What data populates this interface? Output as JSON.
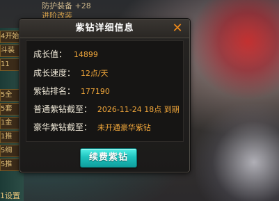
{
  "background": {
    "top_text_1": "防护装备 +28",
    "top_text_2": "进阶改装",
    "left_items": [
      "4开始",
      "斗装",
      "11",
      "5全",
      "5套",
      "1金",
      "1推",
      "5绸",
      "5推"
    ],
    "bottom_text": "1设置"
  },
  "dialog": {
    "title": "紫钻详细信息",
    "close_label": "✕",
    "rows": [
      {
        "label": "成长值：",
        "value": "14899"
      },
      {
        "label": "成长速度：",
        "value": "12点/天"
      },
      {
        "label": "紫钻排名：",
        "value": "177190"
      },
      {
        "label": "普通紫钻截至：",
        "value": "2026-11-24 18点 到期"
      },
      {
        "label": "豪华紫钻截至：",
        "value": "未开通豪华紫钻"
      }
    ],
    "renew_label": "续费紫钻"
  },
  "colors": {
    "accent_orange": "#f0a63a",
    "close_orange": "#f08a1a",
    "button_teal": "#1fc4bf",
    "label_text": "#f1ead9"
  }
}
